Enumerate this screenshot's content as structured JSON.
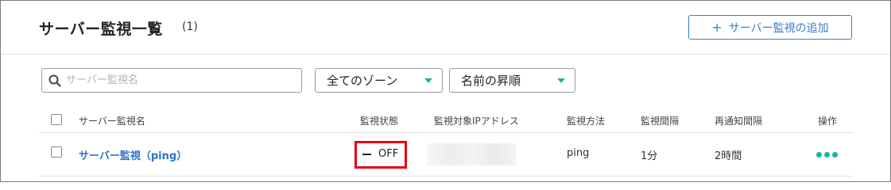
{
  "header": {
    "title": "サーバー監視一覧",
    "count": "(1)",
    "add_button_label": "サーバー監視の追加",
    "add_button_icon": "plus-icon"
  },
  "filters": {
    "search_placeholder": "サーバー監視名",
    "search_value": "",
    "search_icon": "search-icon",
    "zone_select": "全てのゾーン",
    "sort_select": "名前の昇順"
  },
  "table": {
    "columns": {
      "name": "サーバー監視名",
      "status": "監視状態",
      "ip": "監視対象IPアドレス",
      "method": "監視方法",
      "interval": "監視間隔",
      "renotify": "再通知間隔",
      "actions": "操作"
    },
    "rows": [
      {
        "name": "サーバー監視（ping）",
        "status": "OFF",
        "ip": "",
        "method": "ping",
        "interval": "1分",
        "renotify": "2時間"
      }
    ]
  },
  "colors": {
    "accent_blue": "#3b7fc6",
    "link_blue": "#2f73c6",
    "teal": "#17b2a3",
    "highlight_red": "#e60012"
  }
}
